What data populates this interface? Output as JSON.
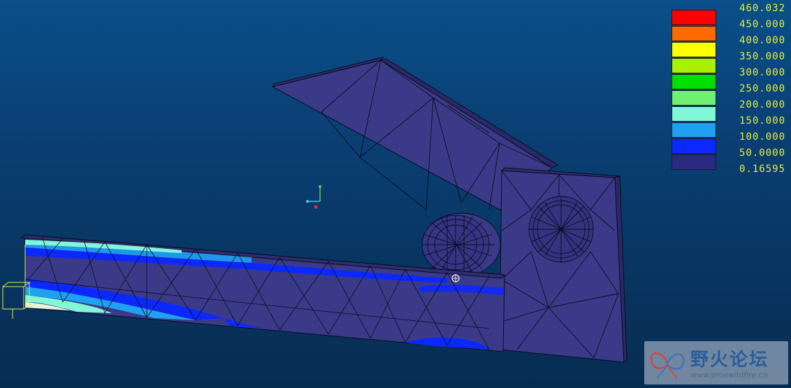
{
  "legend": {
    "colors": [
      "#ff0000",
      "#ff6a00",
      "#ffff00",
      "#aaf000",
      "#00e000",
      "#70f070",
      "#80f8d8",
      "#20a0f0",
      "#0a28ff",
      "#2a2a80"
    ],
    "labels": [
      "460.032",
      "450.000",
      "400.000",
      "350.000",
      "300.000",
      "250.000",
      "200.000",
      "150.000",
      "100.000",
      "50.0000",
      "0.16595"
    ]
  },
  "watermark": {
    "title": "野火论坛",
    "url": "www.proewildfire.cn"
  }
}
